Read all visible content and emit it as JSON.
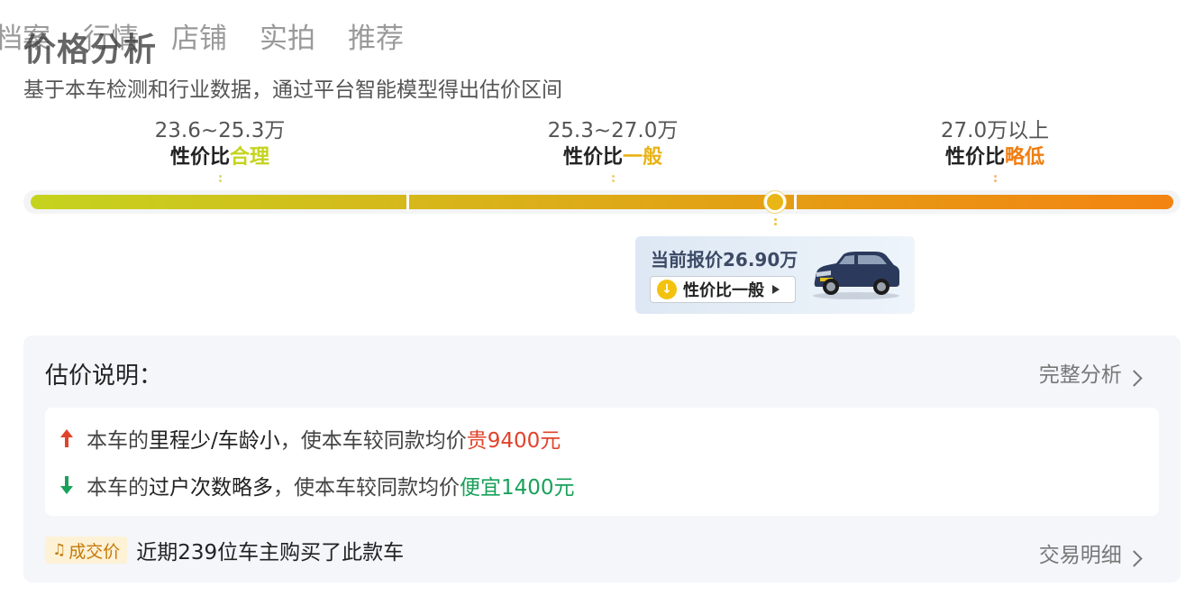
{
  "tabs": [
    "档案",
    "行情",
    "店铺",
    "实拍",
    "推荐"
  ],
  "section": {
    "title": "价格分析",
    "subtitle": "基于本车检测和行业数据，通过平台智能模型得出估价区间"
  },
  "ranges": [
    {
      "price": "23.6~25.3万",
      "label_prefix": "性价比",
      "label_value": "合理",
      "color": "#c5d31e"
    },
    {
      "price": "25.3~27.0万",
      "label_prefix": "性价比",
      "label_value": "一般",
      "color": "#e8b315"
    },
    {
      "price": "27.0万以上",
      "label_prefix": "性价比",
      "label_value": "略低",
      "color": "#f07e12"
    }
  ],
  "price_bar": {
    "range_min": 23.6,
    "range_mid1": 25.3,
    "range_mid2": 27.0,
    "current_price": 26.9,
    "gradient_colors": [
      "#c5d31e",
      "#d6b81b",
      "#e59d14",
      "#f38412"
    ]
  },
  "popup": {
    "current_label": "当前报价26.90万",
    "rating_label": "性价比一般",
    "down_icon": "arrow-down-icon",
    "car_image": "suv-car-image"
  },
  "explanation": {
    "heading": "估价说明：",
    "more_label": "完整分析",
    "items": [
      {
        "prefix": "本车的",
        "feature": "里程少/车龄小",
        "middle": "，使本车较同款均价",
        "impact": "贵9400元",
        "direction": "up",
        "color": "#e0432b"
      },
      {
        "prefix": "本车的",
        "feature": "过户次数略多",
        "middle": "，使本车较同款均价",
        "impact": "便宜1400元",
        "direction": "down",
        "color": "#19a15a"
      }
    ]
  },
  "deal": {
    "badge": "成交价",
    "badge_icon": "bell-icon",
    "text": "近期239位车主购买了此款车",
    "more_label": "交易明细"
  }
}
